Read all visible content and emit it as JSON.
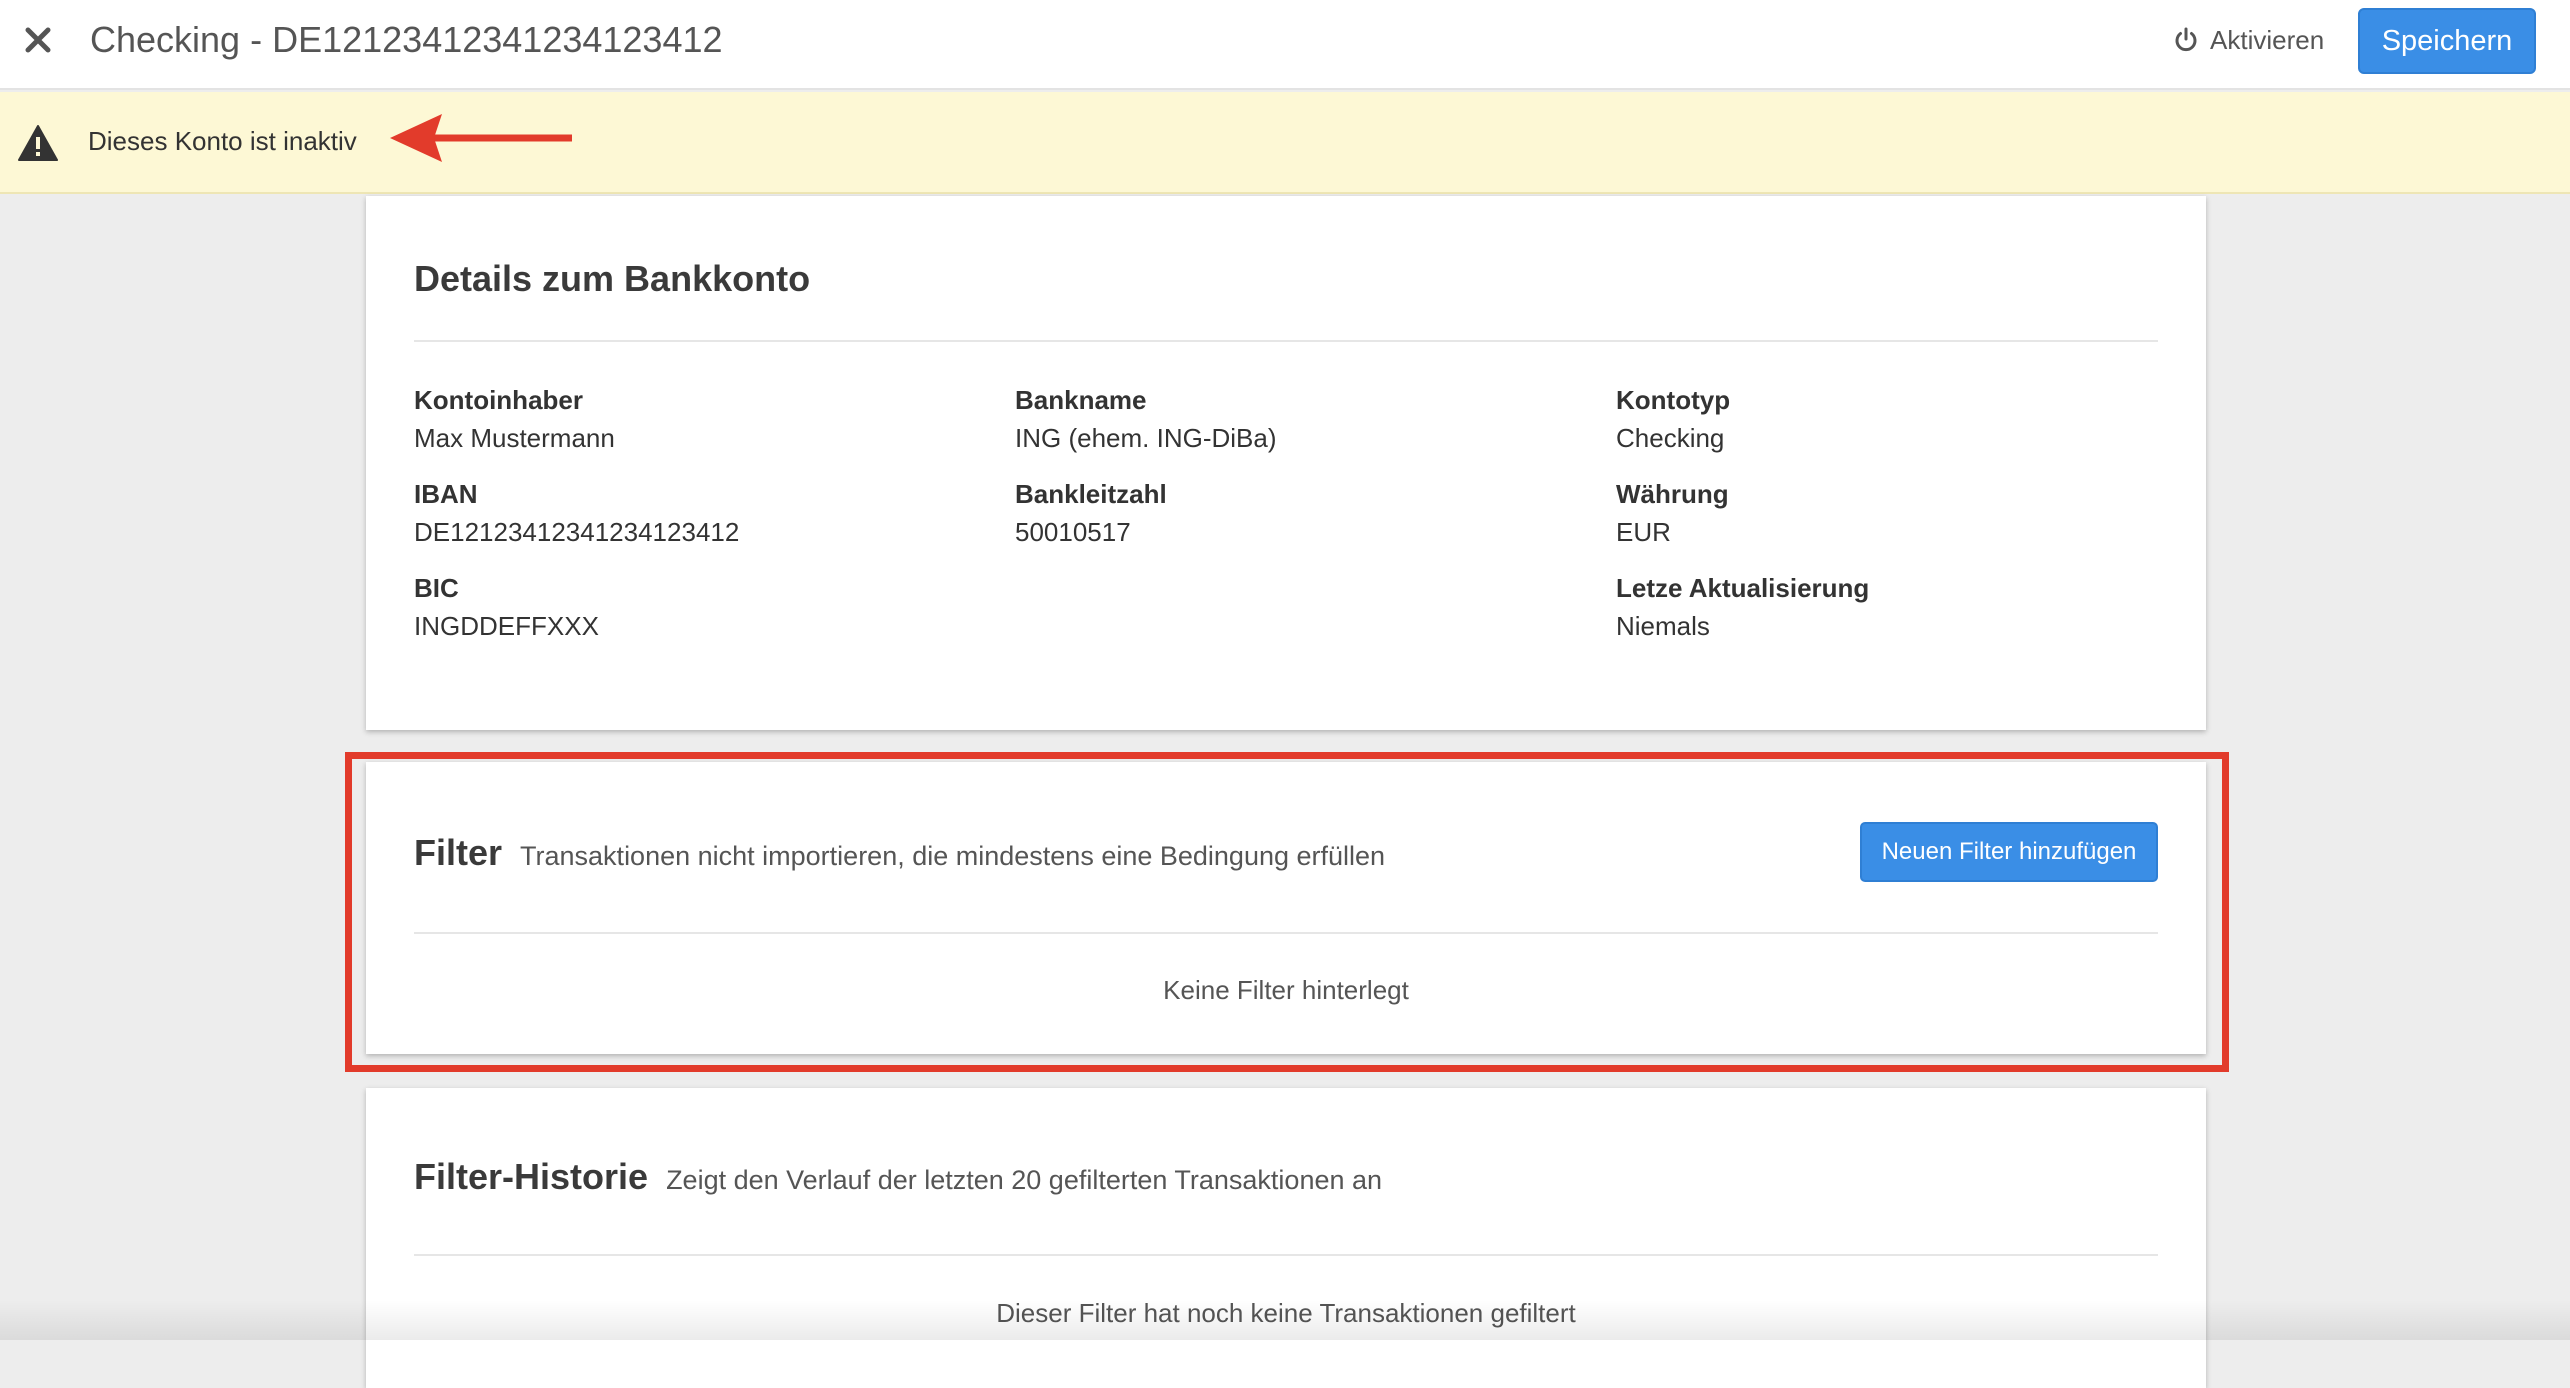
{
  "header": {
    "title": "Checking - DE12123412341234123412",
    "activate_label": "Aktivieren",
    "save_label": "Speichern"
  },
  "banner": {
    "message": "Dieses Konto ist inaktiv"
  },
  "details": {
    "title": "Details zum Bankkonto",
    "fields": [
      {
        "label": "Kontoinhaber",
        "value": "Max Mustermann"
      },
      {
        "label": "IBAN",
        "value": "DE12123412341234123412"
      },
      {
        "label": "BIC",
        "value": "INGDDEFFXXX"
      },
      {
        "label": "Bankname",
        "value": "ING (ehem. ING-DiBa)"
      },
      {
        "label": "Bankleitzahl",
        "value": "50010517"
      },
      {
        "label": "Kontotyp",
        "value": "Checking"
      },
      {
        "label": "Währung",
        "value": "EUR"
      },
      {
        "label": "Letze Aktualisierung",
        "value": "Niemals"
      }
    ]
  },
  "filter": {
    "title": "Filter",
    "subtitle": "Transaktionen nicht importieren, die mindestens eine Bedingung erfüllen",
    "add_label": "Neuen Filter hinzufügen",
    "empty_text": "Keine Filter hinterlegt"
  },
  "history": {
    "title": "Filter-Historie",
    "subtitle": "Zeigt den Verlauf der letzten 20 gefilterten Transaktionen an",
    "empty_text": "Dieser Filter hat noch keine Transaktionen gefiltert"
  },
  "colors": {
    "primary": "#3a8ee6",
    "banner_bg": "#fdf8d5",
    "annotation": "#e23b2b"
  },
  "icons": {
    "close": "close-icon",
    "power": "power-icon",
    "warning": "warning-icon",
    "annotation_arrow": "arrow-left-icon"
  }
}
